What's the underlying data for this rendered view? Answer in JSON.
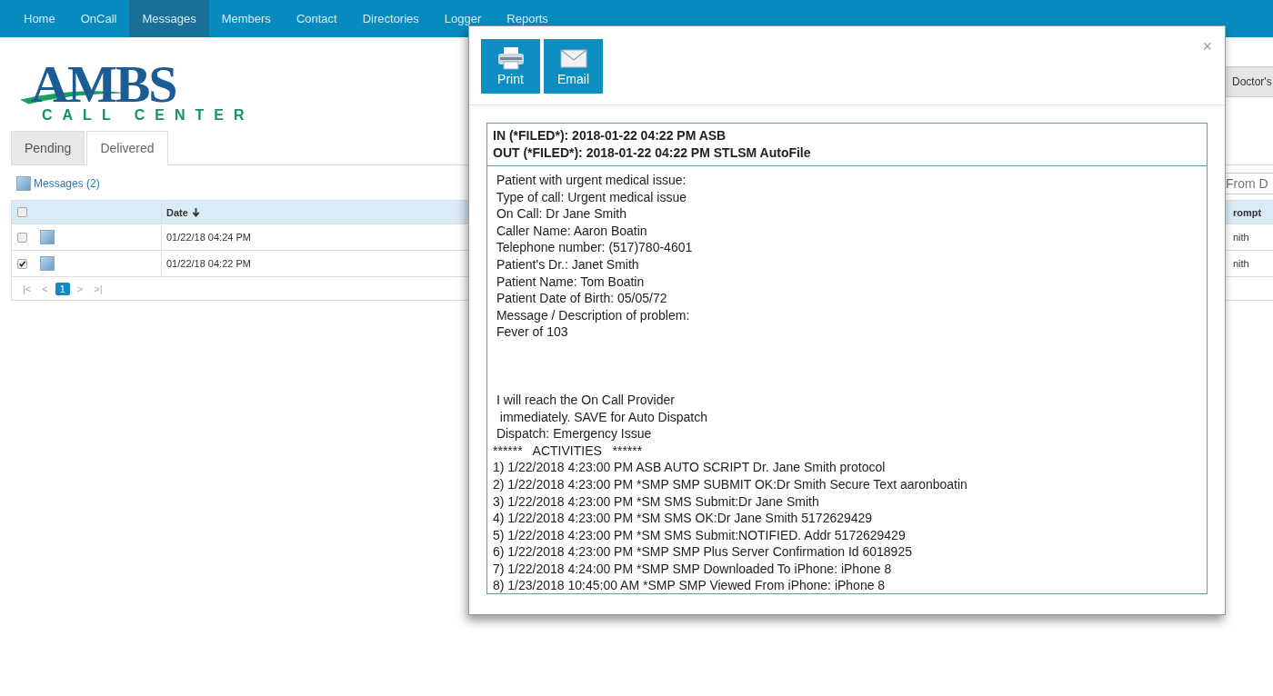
{
  "nav": [
    {
      "label": "Home",
      "selected": false
    },
    {
      "label": "OnCall",
      "selected": false
    },
    {
      "label": "Messages",
      "selected": true
    },
    {
      "label": "Members",
      "selected": false
    },
    {
      "label": "Contact",
      "selected": false
    },
    {
      "label": "Directories",
      "selected": false
    },
    {
      "label": "Logger",
      "selected": false
    },
    {
      "label": "Reports",
      "selected": false
    }
  ],
  "logo": {
    "name": "AMBS",
    "tagline": "CALL CENTER"
  },
  "doctors_button": "Doctor's",
  "tabs": [
    {
      "label": "Pending",
      "selected": false
    },
    {
      "label": "Delivered",
      "selected": true
    }
  ],
  "messages_link": "Messages (2)",
  "date_filter": {
    "placeholder": "From D"
  },
  "table": {
    "header_checked": false,
    "columns": [
      "Date",
      "rompt"
    ],
    "rows": [
      {
        "checked": false,
        "date": "01/22/18 04:24 PM",
        "column_2": "nith"
      },
      {
        "checked": true,
        "date": "01/22/18 04:22 PM",
        "column_2": "nith"
      }
    ]
  },
  "pager": {
    "first": "|<",
    "prev": "<",
    "pages": [
      {
        "label": "1",
        "selected": true
      }
    ],
    "next": ">",
    "last": ">|"
  },
  "modal": {
    "buttons": [
      {
        "kind": "print",
        "label": "Print"
      },
      {
        "kind": "email",
        "label": "Email"
      }
    ],
    "close": "×",
    "header": [
      "IN (*FILED*): 2018-01-22 04:22 PM ASB",
      "OUT (*FILED*): 2018-01-22 04:22 PM STLSM AutoFile"
    ],
    "blocks": [
      [
        " Patient with urgent medical issue:",
        " Type of call: Urgent medical issue",
        " On Call: Dr Jane Smith",
        " Caller Name: Aaron Boatin",
        " Telephone number: (517)780-4601",
        " Patient's Dr.: Janet Smith",
        " Patient Name: Tom Boatin",
        " Patient Date of Birth: 05/05/72",
        " Message / Description of problem:",
        " Fever of 103"
      ],
      [
        " I will reach the On Call Provider",
        "  immediately. SAVE for Auto Dispatch",
        " Dispatch: Emergency Issue",
        "******   ACTIVITIES   ******",
        "1) 1/22/2018 4:23:00 PM ASB AUTO SCRIPT Dr. Jane Smith protocol",
        "2) 1/22/2018 4:23:00 PM *SMP SMP SUBMIT OK:Dr Smith Secure Text aaronboatin",
        "3) 1/22/2018 4:23:00 PM *SM SMS Submit:Dr Jane Smith",
        "4) 1/22/2018 4:23:00 PM *SM SMS OK:Dr Jane Smith 5172629429",
        "5) 1/22/2018 4:23:00 PM *SM SMS Submit:NOTIFIED. Addr 5172629429",
        "6) 1/22/2018 4:23:00 PM *SMP SMP Plus Server Confirmation Id 6018925",
        "7) 1/22/2018 4:24:00 PM *SMP SMP Downloaded To iPhone: iPhone 8",
        "8) 1/23/2018 10:45:00 AM *SMP SMP Viewed From iPhone: iPhone 8"
      ]
    ]
  }
}
